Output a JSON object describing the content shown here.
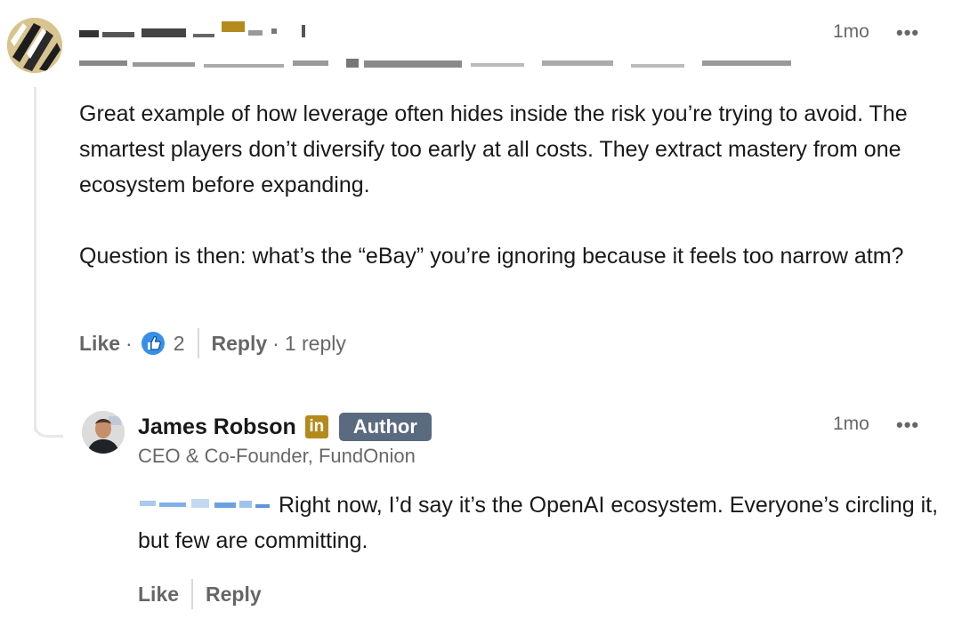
{
  "comment": {
    "time": "1mo",
    "menu_label": "•••",
    "paragraphs": [
      "Great example of how leverage often hides inside the risk you’re trying to avoid. The smartest players don’t diversify too early at all costs. They extract mastery from one ecosystem before expanding.",
      "Question is then: what’s the “eBay” you’re ignoring because it feels too narrow atm?"
    ],
    "like_label": "Like",
    "separator": "·",
    "reaction_count": "2",
    "reply_label": "Reply",
    "reply_count": "1 reply"
  },
  "reply": {
    "author_name": "James Robson",
    "linkedin_badge": "in",
    "author_badge": "Author",
    "headline": "CEO & Co-Founder, FundOnion",
    "time": "1mo",
    "menu_label": "•••",
    "text": "Right now, I’d say it’s the OpenAI ecosystem. Everyone’s circling it, but few are committing.",
    "like_label": "Like",
    "reply_label": "Reply"
  },
  "colors": {
    "accent_blue": "#378fe9",
    "badge_gold": "#b58a1d",
    "author_badge": "#5a6b80",
    "thread_line": "#e8e8e8"
  },
  "icons": {
    "reaction": "thumbs-up-icon",
    "menu": "more-horizontal-icon"
  }
}
